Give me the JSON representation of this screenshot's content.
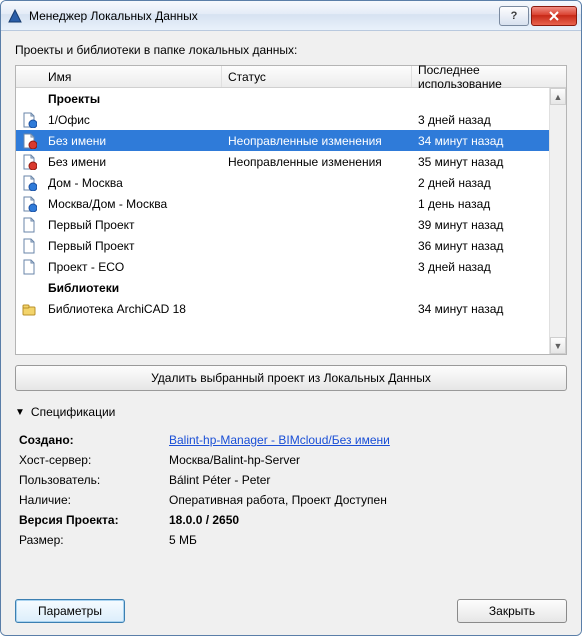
{
  "window": {
    "title": "Менеджер Локальных Данных"
  },
  "prompt": "Проекты и библиотеки в папке локальных данных:",
  "columns": {
    "name": "Имя",
    "status": "Статус",
    "last": "Последнее использование"
  },
  "groups": {
    "projects": "Проекты",
    "libraries": "Библиотеки"
  },
  "rows": [
    {
      "icon": "blue",
      "name": "1/Офис",
      "status": "",
      "last": "3 дней назад",
      "selected": false
    },
    {
      "icon": "red",
      "name": "Без имени",
      "status": "Неоправленные изменения",
      "last": "34 минут назад",
      "selected": true
    },
    {
      "icon": "red",
      "name": "Без имени",
      "status": "Неоправленные изменения",
      "last": "35 минут назад",
      "selected": false
    },
    {
      "icon": "blue",
      "name": "Дом - Москва",
      "status": "",
      "last": "2 дней назад",
      "selected": false
    },
    {
      "icon": "blue",
      "name": "Москва/Дом - Москва",
      "status": "",
      "last": "1 день назад",
      "selected": false
    },
    {
      "icon": "plain",
      "name": "Первый Проект",
      "status": "",
      "last": "39 минут назад",
      "selected": false
    },
    {
      "icon": "plain",
      "name": "Первый Проект",
      "status": "",
      "last": "36 минут назад",
      "selected": false
    },
    {
      "icon": "plain",
      "name": "Проект - ECO",
      "status": "",
      "last": "3 дней назад",
      "selected": false
    }
  ],
  "library_rows": [
    {
      "icon": "lib",
      "name": "Библиотека ArchiCAD 18",
      "status": "",
      "last": "34 минут назад"
    }
  ],
  "delete_button": "Удалить выбранный проект из Локальных Данных",
  "spec_toggle": "Спецификации",
  "spec": {
    "created_label": "Создано:",
    "created_link": "Balint-hp-Manager - BIMcloud/Без имени",
    "host_label": "Хост-сервер:",
    "host_value": "Москва/Balint-hp-Server",
    "user_label": "Пользователь:",
    "user_value": "Bálint Péter - Peter",
    "avail_label": "Наличие:",
    "avail_value": "Оперативная работа, Проект Доступен",
    "version_label": "Версия Проекта:",
    "version_value": "18.0.0 / 2650",
    "size_label": "Размер:",
    "size_value": "5 МБ"
  },
  "footer": {
    "params": "Параметры",
    "close": "Закрыть"
  }
}
